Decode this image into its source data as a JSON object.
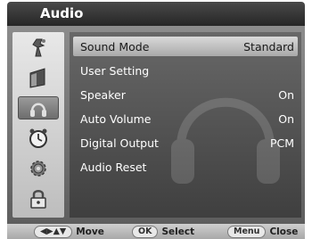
{
  "header": {
    "title": "Audio"
  },
  "tabs": [
    {
      "icon": "antenna-icon"
    },
    {
      "icon": "picture-icon"
    },
    {
      "icon": "headphones-icon",
      "active": true
    },
    {
      "icon": "clock-icon"
    },
    {
      "icon": "gear-icon"
    },
    {
      "icon": "lock-icon"
    }
  ],
  "menu": {
    "items": [
      {
        "label": "Sound Mode",
        "value": "Standard"
      },
      {
        "label": "User Setting",
        "value": ""
      },
      {
        "label": "Speaker",
        "value": "On"
      },
      {
        "label": "Auto Volume",
        "value": "On"
      },
      {
        "label": "Digital Output",
        "value": "PCM"
      },
      {
        "label": "Audio Reset",
        "value": ""
      }
    ],
    "selected_index": 0
  },
  "footer": {
    "move_key": "◀▶▲▼",
    "move_label": "Move",
    "select_key": "OK",
    "select_label": "Select",
    "close_key": "Menu",
    "close_label": "Close"
  }
}
